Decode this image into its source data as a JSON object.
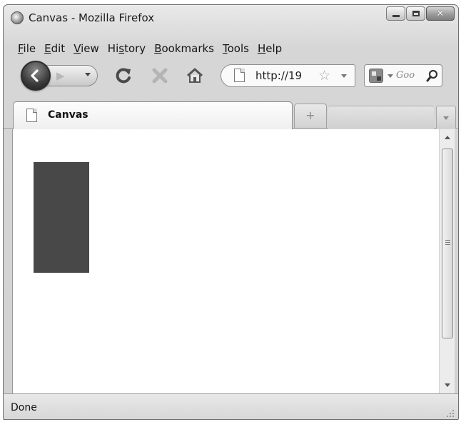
{
  "window": {
    "title": "Canvas - Mozilla Firefox",
    "close_glyph": "✕"
  },
  "menubar": {
    "items": [
      {
        "label": "File",
        "accel": "F"
      },
      {
        "label": "Edit",
        "accel": "E"
      },
      {
        "label": "View",
        "accel": "V"
      },
      {
        "label": "History",
        "accel": "s"
      },
      {
        "label": "Bookmarks",
        "accel": "B"
      },
      {
        "label": "Tools",
        "accel": "T"
      },
      {
        "label": "Help",
        "accel": "H"
      }
    ]
  },
  "navbar": {
    "url": "http://19",
    "search_placeholder": "Goo",
    "icons": [
      "back-icon",
      "forward-icon",
      "reload-icon",
      "stop-icon",
      "home-icon",
      "page-icon",
      "bookmark-star-icon",
      "search-engine-icon",
      "search-icon"
    ]
  },
  "tabs": [
    {
      "label": "Canvas",
      "active": true
    }
  ],
  "newtab_glyph": "+",
  "content": {
    "rect_color": "#484848"
  },
  "status": {
    "text": "Done"
  },
  "colors": {
    "chrome": "#d6d6d6",
    "content_bg": "#ffffff"
  }
}
